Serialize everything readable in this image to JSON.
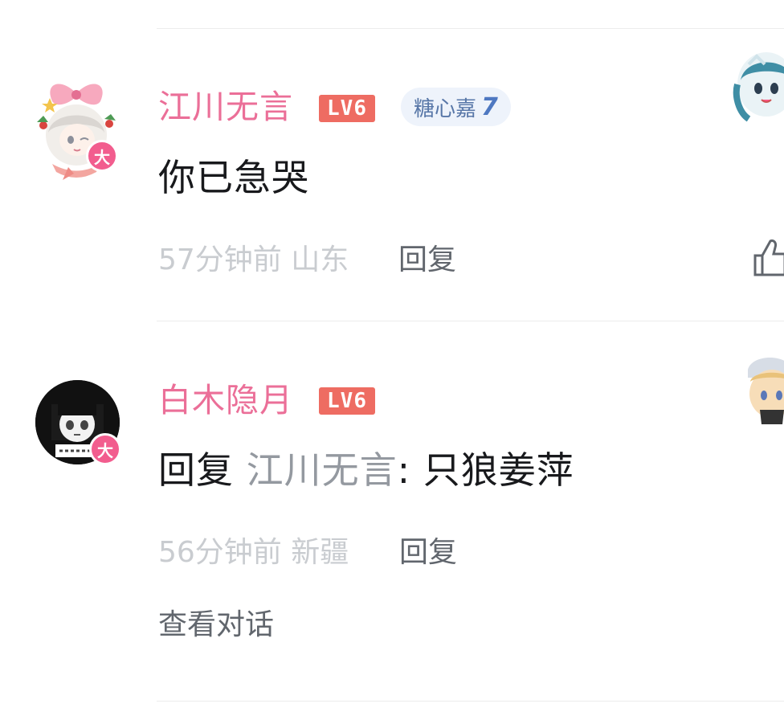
{
  "comments": [
    {
      "username": "江川无言",
      "level": "LV6",
      "fan_badge": {
        "name": "糖心嘉",
        "level": "7"
      },
      "avatar_badge": "大",
      "text": "你已急哭",
      "time": "57分钟前",
      "location": "山东",
      "reply_label": "回复"
    },
    {
      "username": "白木隐月",
      "level": "LV6",
      "avatar_badge": "大",
      "reply_prefix": "回复",
      "reply_to": "江川无言",
      "text": ": 只狼姜萍",
      "time": "56分钟前",
      "location": "新疆",
      "reply_label": "回复",
      "view_conversation": "查看对话"
    }
  ],
  "colors": {
    "username": "#eb6f98",
    "level_badge": "#ee6c62",
    "avatar_badge": "#f25d8e",
    "fan_badge_bg": "#eef3fb",
    "fan_badge_text": "#5877a8",
    "meta_text": "#c9ccd0",
    "action_text": "#61666d",
    "body_text": "#18191c"
  }
}
